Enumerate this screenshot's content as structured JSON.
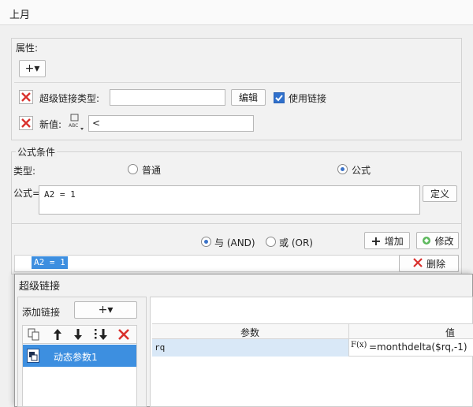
{
  "window": {
    "title": "上月"
  },
  "properties": {
    "heading": "属性:",
    "add_label": "+▾",
    "hyperlink_type_label": "超级链接类型:",
    "hyperlink_type_value": "",
    "edit_label": "编辑",
    "use_link_label": "使用链接",
    "use_link_checked": true,
    "new_value_label": "新值:",
    "new_value": "<"
  },
  "formula_condition": {
    "heading": "公式条件",
    "type_label": "类型:",
    "option_normal": "普通",
    "option_formula": "公式",
    "selected": "公式",
    "formula_label": "公式=",
    "formula_value": "A2 = 1",
    "define_label": "定义",
    "and_label": "与 (AND)",
    "or_label": "或 (OR)",
    "and_selected": true,
    "add_label": "增加",
    "modify_label": "修改",
    "delete_label": "删除",
    "conditions": [
      "A2 = 1"
    ]
  },
  "hyperlink_dialog": {
    "title": "超级链接",
    "add_link_label": "添加链接",
    "add_button_label": "+▾",
    "links": [
      "动态参数1"
    ],
    "param_table": {
      "headers": [
        "参数",
        "值"
      ],
      "rows": [
        {
          "param": "rq",
          "value": "=monthdelta($rq,-1)"
        }
      ]
    },
    "fx_label": "F(x)"
  },
  "colors": {
    "selection": "#3d8fe0",
    "table_row": "#d9e8f7",
    "accent": "#2f70cc",
    "delete": "#d9302c"
  }
}
